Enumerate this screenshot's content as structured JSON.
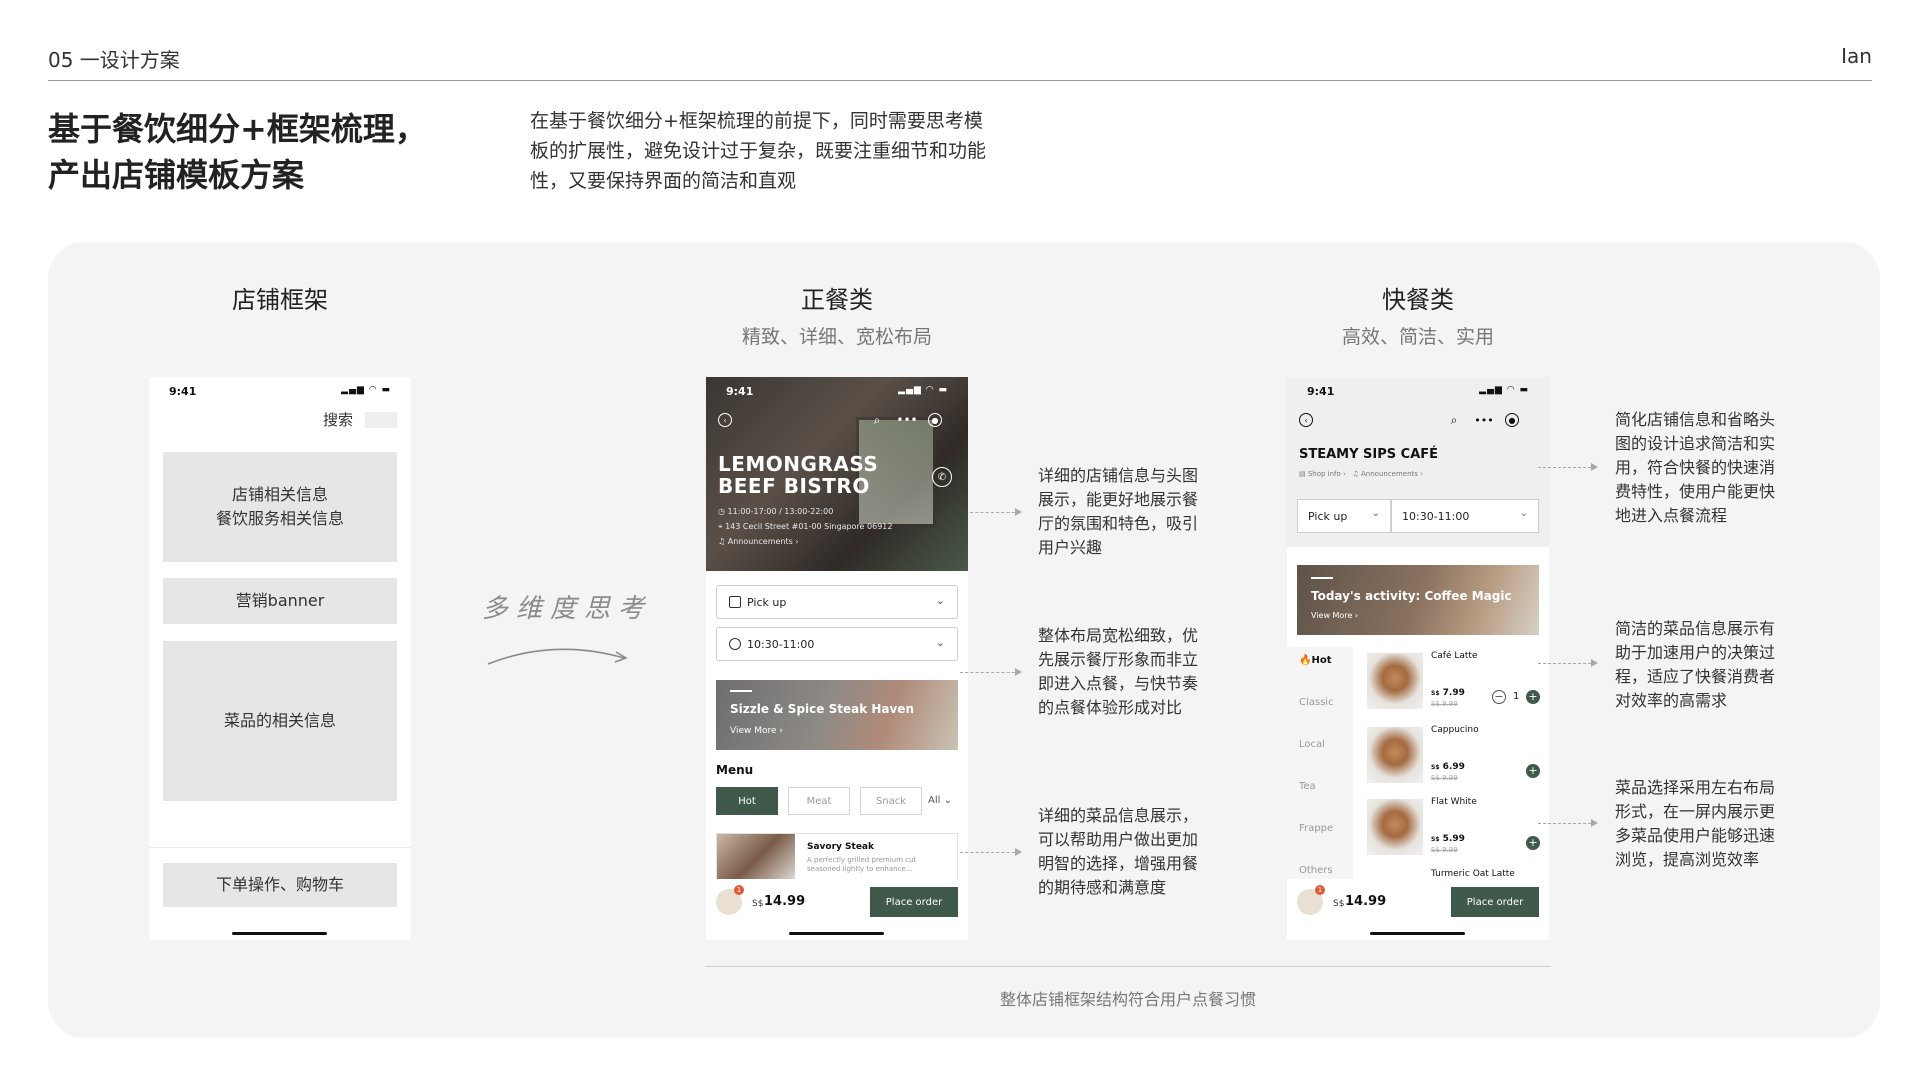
{
  "header": {
    "tag": "05 一设计方案",
    "author": "Ian"
  },
  "title": {
    "line1": "基于餐饮细分+框架梳理，",
    "line2": "产出店铺模板方案"
  },
  "intro": "在基于餐饮细分+框架梳理的前提下，同时需要思考模板的扩展性，避免设计过于复杂，既要注重细节和功能性，又要保持界面的简洁和直观",
  "columns": [
    {
      "title": "店铺框架",
      "subtitle": ""
    },
    {
      "title": "正餐类",
      "subtitle": "精致、详细、宽松布局"
    },
    {
      "title": "快餐类",
      "subtitle": "高效、简洁、实用"
    }
  ],
  "wireframe": {
    "time": "9:41",
    "search": "搜索",
    "block1_line1": "店铺相关信息",
    "block1_line2": "餐饮服务相关信息",
    "block2": "营销banner",
    "block3": "菜品的相关信息",
    "block4": "下单操作、购物车"
  },
  "handwritten": "多维度思考",
  "bistro": {
    "time": "9:41",
    "name_line1": "LEMONGRASS",
    "name_line2": "BEEF BISTRO",
    "hours": "11:00-17:00 / 13:00-22:00",
    "address": "143 Cecil Street #01-00 Singapore 06912",
    "announcements": "Announcements ›",
    "pickup": "Pick up",
    "time_slot": "10:30-11:00",
    "banner_title": "Sizzle & Spice Steak Haven",
    "banner_link": "View More  ›",
    "menu_label": "Menu",
    "tabs": [
      "Hot",
      "Meat",
      "Snack"
    ],
    "tab_all": "All ⌄",
    "dish_name": "Savory Steak",
    "dish_desc": "A perfectly grilled premium cut seasoned lightly to enhance...",
    "cart_badge": "1",
    "currency": "S$",
    "total": "14.99",
    "order_button": "Place order"
  },
  "cafe": {
    "time": "9:41",
    "name": "STEAMY SIPS CAFÉ",
    "shop_info": "Shop info ›",
    "announcements": "Announcements ›",
    "pickup": "Pick up",
    "time_slot": "10:30-11:00",
    "banner_title": "Today's activity: Coffee Magic",
    "banner_link": "View More  ›",
    "categories": [
      "Hot",
      "Classic",
      "Local",
      "Tea",
      "Frappe",
      "Others"
    ],
    "items": [
      {
        "name": "Café Latte",
        "price": "7.99",
        "old": "S$ 9.99"
      },
      {
        "name": "Cappucino",
        "price": "6.99",
        "old": "S$ 9.99"
      },
      {
        "name": "Flat White",
        "price": "5.99",
        "old": "S$ 9.99"
      },
      {
        "name": "Turmeric Oat Latte",
        "price": "",
        "old": ""
      }
    ],
    "qty": "1",
    "cart_badge": "1",
    "currency": "S$",
    "total": "14.99",
    "order_button": "Place order"
  },
  "notes": {
    "bistro_1": "详细的店铺信息与头图展示，能更好地展示餐厅的氛围和特色，吸引用户兴趣",
    "bistro_2": "整体布局宽松细致，优先展示餐厅形象而非立即进入点餐，与快节奏的点餐体验形成对比",
    "bistro_3": "详细的菜品信息展示，可以帮助用户做出更加明智的选择，增强用餐的期待感和满意度",
    "cafe_1": "简化店铺信息和省略头图的设计追求简洁和实用，符合快餐的快速消费特性，使用户能更快地进入点餐流程",
    "cafe_2": "简洁的菜品信息展示有助于加速用户的决策过程，适应了快餐消费者对效率的高需求",
    "cafe_3": "菜品选择采用左右布局形式，在一屏内展示更多菜品使用户能够迅速浏览，提高浏览效率"
  },
  "footer": "整体店铺框架结构符合用户点餐习惯",
  "colors": {
    "accent": "#3f5a4b",
    "panel": "#f4f4f4",
    "badge": "#e05a3a"
  }
}
